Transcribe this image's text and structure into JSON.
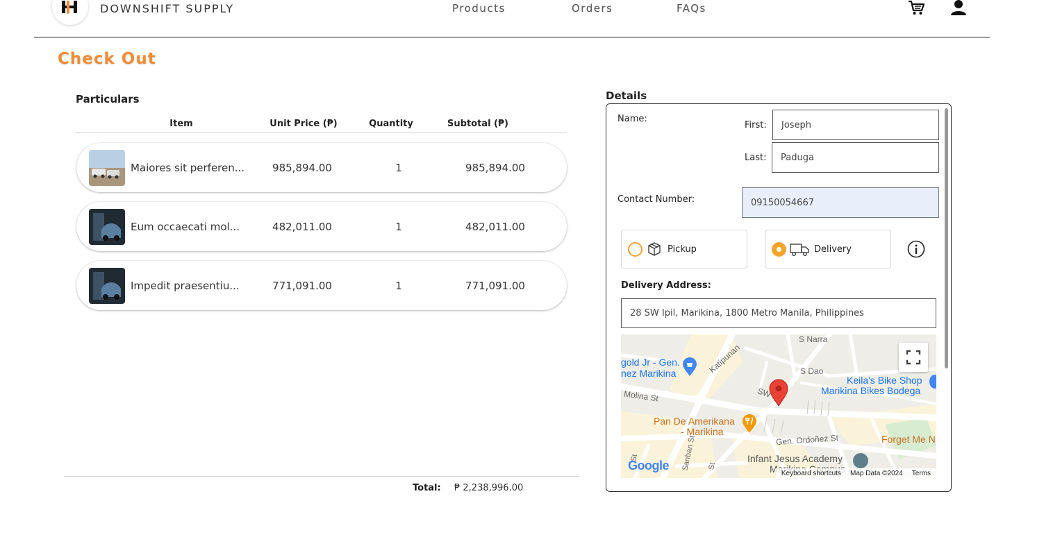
{
  "header": {
    "brand": "DOWNSHIFT SUPPLY",
    "nav": [
      "Products",
      "Orders",
      "FAQs"
    ],
    "cart_icon": "cart-icon",
    "user_icon": "user-icon"
  },
  "page_title": "Check Out",
  "particulars": {
    "heading": "Particulars",
    "columns": [
      "Item",
      "Unit Price (₱)",
      "Quantity",
      "Subtotal (₱)"
    ],
    "rows": [
      {
        "name": "Maiores sit perferen...",
        "unit_price": "985,894.00",
        "quantity": "1",
        "subtotal": "985,894.00"
      },
      {
        "name": "Eum occaecati mol...",
        "unit_price": "482,011.00",
        "quantity": "1",
        "subtotal": "482,011.00"
      },
      {
        "name": "Impedit praesentiu...",
        "unit_price": "771,091.00",
        "quantity": "1",
        "subtotal": "771,091.00"
      }
    ],
    "total_label": "Total:",
    "total_value": "₱ 2,238,996.00"
  },
  "details": {
    "heading": "Details",
    "name_label": "Name:",
    "first_label": "First:",
    "first_value": "Joseph",
    "last_label": "Last:",
    "last_value": "Paduga",
    "contact_label": "Contact Number:",
    "contact_value": "09150054667",
    "pickup_label": "Pickup",
    "delivery_label": "Delivery",
    "selected_option": "Delivery",
    "address_label": "Delivery Address:",
    "address_value": "28 SW Ipil, Marikina, 1800 Metro Manila, Philippines",
    "map": {
      "labels": {
        "place1_a": "gold Jr - Gen.",
        "place1_b": "nez Marikina",
        "katipunan": "Katipunan",
        "s_narra": "S Narra",
        "s_dao": "S Dao",
        "molina": "Molina St",
        "sw_ipil": "SW Ipil",
        "keila_a": "Keila's Bike Shop",
        "keila_b": "Marikina Bikes Bodega",
        "pan_a": "Pan De Amerikana",
        "pan_b": "- Marikina",
        "ordonez": "Gen. Ordoñez St",
        "forget": "Forget Me N",
        "infant_a": "Infant Jesus Academy",
        "infant_b": "Marikina Campus",
        "st1": "St",
        "st2": "St",
        "banban": "Sanban St"
      },
      "footer": [
        "Keyboard shortcuts",
        "Map Data ©2024",
        "Terms"
      ],
      "google": "Google"
    }
  },
  "colors": {
    "accent": "#f28c38",
    "radio": "#f5a623",
    "highlight_field": "#e8effb"
  }
}
